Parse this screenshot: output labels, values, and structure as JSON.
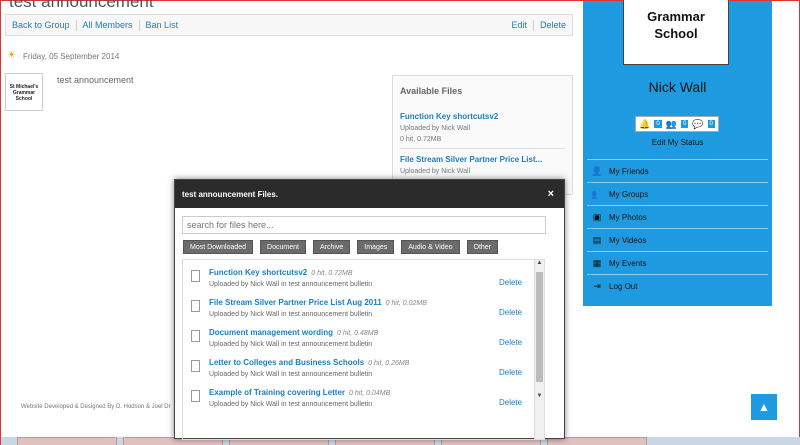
{
  "page": {
    "title": "test announcement"
  },
  "nav": {
    "back": "Back to Group",
    "members": "All Members",
    "ban": "Ban List",
    "edit": "Edit",
    "delete": "Delete"
  },
  "post": {
    "date": "Friday, 05 September 2014",
    "logo_text": "St Michael's Grammar School",
    "text": "test announcement"
  },
  "available_files": {
    "title": "Available Files",
    "items": [
      {
        "name": "Function Key shortcutsv2",
        "uploaded": "Uploaded by Nick Wall",
        "meta": "0 hit, 0.72MB"
      },
      {
        "name": "File Stream Silver Partner Price List...",
        "uploaded": "Uploaded by Nick Wall"
      }
    ]
  },
  "footer": {
    "text": "Website Developed & Designed By D. Hodson & Joel Dr"
  },
  "profile": {
    "card_text": "Grammar School",
    "name": "Nick Wall",
    "notif_counts": [
      "0",
      "0",
      "0"
    ],
    "edit_status": "Edit My Status",
    "menu": [
      {
        "label": "My Friends",
        "icon": "friends-icon"
      },
      {
        "label": "My Groups",
        "icon": "groups-icon"
      },
      {
        "label": "My Photos",
        "icon": "photos-icon"
      },
      {
        "label": "My Videos",
        "icon": "videos-icon"
      },
      {
        "label": "My Events",
        "icon": "events-icon"
      },
      {
        "label": "Log Out",
        "icon": "logout-icon"
      }
    ]
  },
  "modal": {
    "title": "test announcement Files.",
    "close": "×",
    "search_placeholder": "search for files here...",
    "filters": [
      "Most Downloaded",
      "Document",
      "Archive",
      "Images",
      "Audio & Video",
      "Other"
    ],
    "delete_label": "Delete",
    "files": [
      {
        "name": "Function Key shortcutsv2",
        "hit": "0 hit, 0.72MB",
        "uploaded": "Uploaded by Nick Wall in test announcement bulletin"
      },
      {
        "name": "File Stream Silver Partner Price List Aug 2011",
        "hit": "0 hit, 0.02MB",
        "uploaded": "Uploaded by Nick Wall in test announcement bulletin"
      },
      {
        "name": "Document management wording",
        "hit": "0 hit, 0.48MB",
        "uploaded": "Uploaded by Nick Wall in test announcement bulletin"
      },
      {
        "name": "Letter to Colleges and Business Schools",
        "hit": "0 hit, 0.26MB",
        "uploaded": "Uploaded by Nick Wall in test announcement bulletin"
      },
      {
        "name": "Example of Training covering Letter",
        "hit": "0 hit, 0.04MB",
        "uploaded": "Uploaded by Nick Wall in test announcement bulletin"
      }
    ]
  }
}
